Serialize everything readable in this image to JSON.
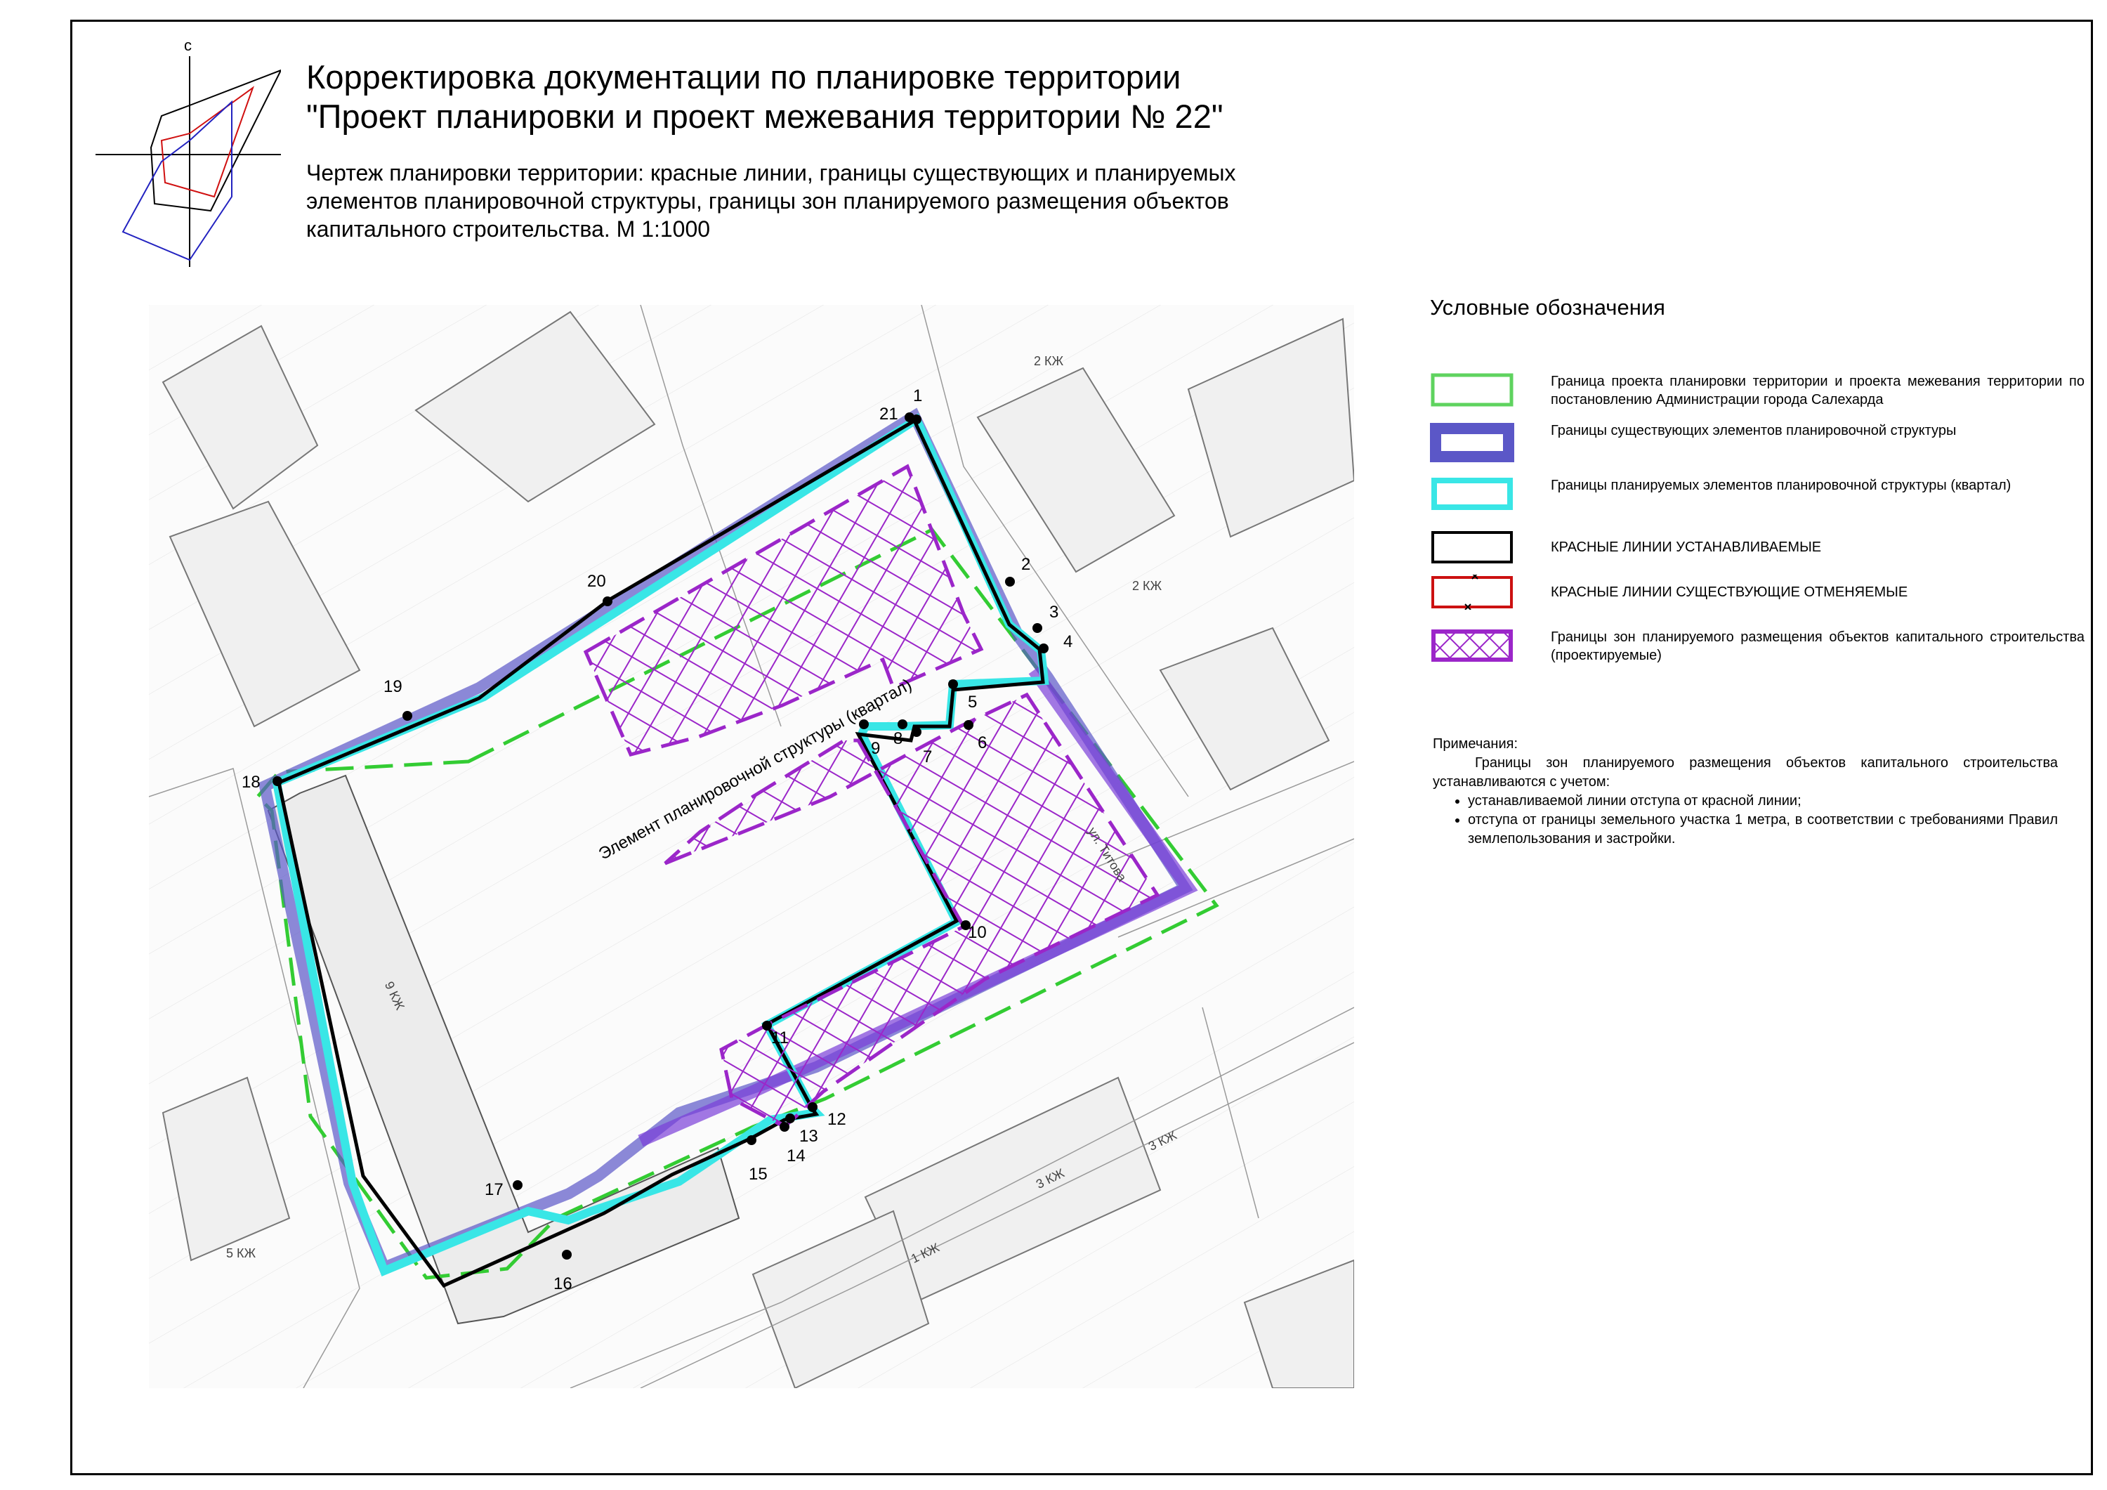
{
  "title": {
    "line1": "Корректировка документации по планировке территории",
    "line2": "\"Проект планировки и проект межевания территории № 22\""
  },
  "subtitle": {
    "line1": "Чертеж планировки территории: красные линии, границы существующих и планируемых",
    "line2": "элементов планировочной структуры, границы зон планируемого размещения объектов",
    "line3": "капитального строительства. М 1:1000"
  },
  "compass": {
    "north_label": "с"
  },
  "map": {
    "element_caption": "Элемент планировочной структуры (квартал)",
    "points": [
      "1",
      "2",
      "3",
      "4",
      "5",
      "6",
      "7",
      "8",
      "9",
      "10",
      "11",
      "12",
      "13",
      "14",
      "15",
      "16",
      "17",
      "18",
      "19",
      "20",
      "21"
    ],
    "street_label": "ул. Титова",
    "block_labels": [
      "1 КЖ",
      "3 КЖ",
      "3 КЖ",
      "2 КЖ",
      "2 КЖ",
      "5 КЖ",
      "9 КЖ"
    ]
  },
  "legend": {
    "title": "Условные  обозначения",
    "items": [
      {
        "text": "Граница проекта планировки территории и проекта межевания территории по постановлению Администрации города Салехарда",
        "color": "#5fd35f"
      },
      {
        "text": "Границы существующих элементов планировочной структуры",
        "color": "#5b57c7"
      },
      {
        "text": "Границы планируемых элементов планировочной структуры (квартал)",
        "color": "#39e6e6"
      },
      {
        "text": "КРАСНЫЕ ЛИНИИ УСТАНАВЛИВАЕМЫЕ",
        "color": "#000000"
      },
      {
        "text": "КРАСНЫЕ ЛИНИИ СУЩЕСТВУЮЩИЕ ОТМЕНЯЕМЫЕ",
        "color": "#cc1111"
      },
      {
        "text": "Границы зон планируемого размещения объектов капитального строительства (проектируемые)",
        "color": "#9b26c9"
      }
    ]
  },
  "notes": {
    "title": "Примечания:",
    "paragraph": "Границы зон планируемого размещения объектов капитального строительства устанавливаются с учетом:",
    "bullets": [
      "устанавливаемой линии отступа от красной линии;",
      "отступа от границы земельного участка 1 метра, в соответствии с требованиями Правил землепользования и застройки."
    ]
  }
}
